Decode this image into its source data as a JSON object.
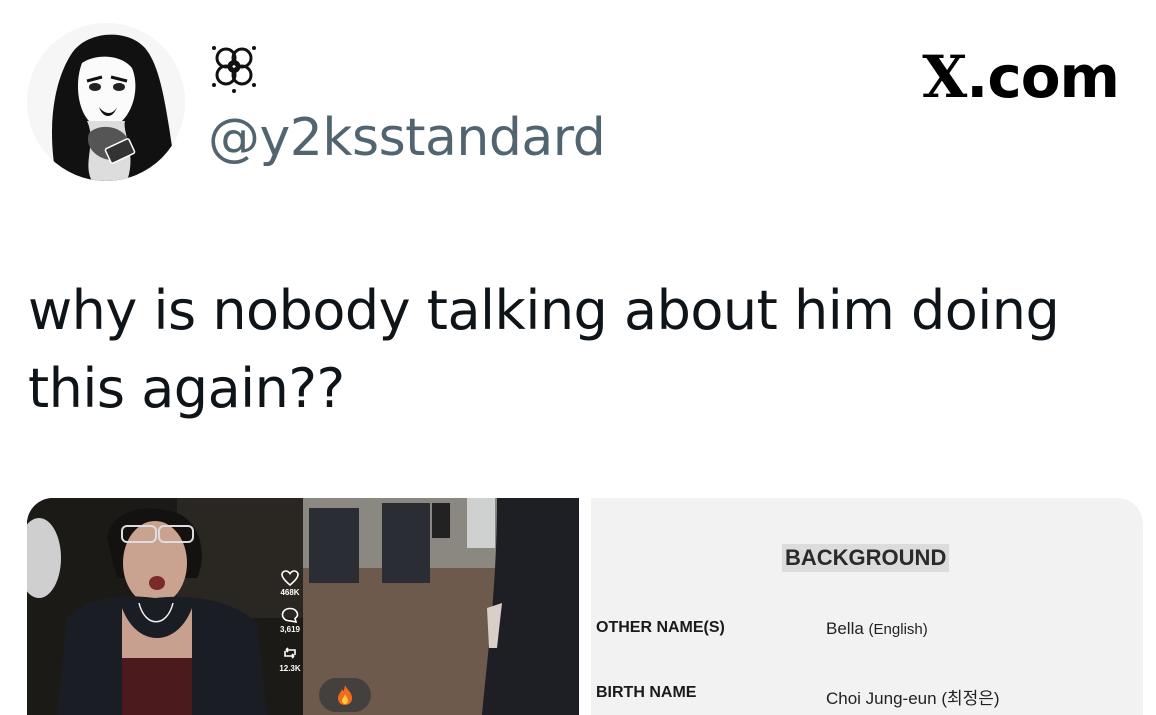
{
  "author": {
    "display_name_icon": "flower-emoji-icon",
    "handle": "@y2ksstandard",
    "avatar_icon": "manga-girl-avatar"
  },
  "brand": {
    "logo_letter": "X",
    "logo_suffix": ".com"
  },
  "tweet": {
    "line1": "why is nobody talking about him doing",
    "line2": "this again??"
  },
  "media_left": {
    "likes": "468K",
    "comments": "3,619",
    "reposts": "12.3K",
    "fire_icon": "fire-emoji-icon"
  },
  "media_right": {
    "section_title": "BACKGROUND",
    "rows": [
      {
        "label": "OTHER NAME(S)",
        "value": "Bella",
        "value_note": "(English)"
      },
      {
        "label": "BIRTH NAME",
        "value": "Choi Jung-eun",
        "value_note": "(최정은)"
      }
    ]
  }
}
